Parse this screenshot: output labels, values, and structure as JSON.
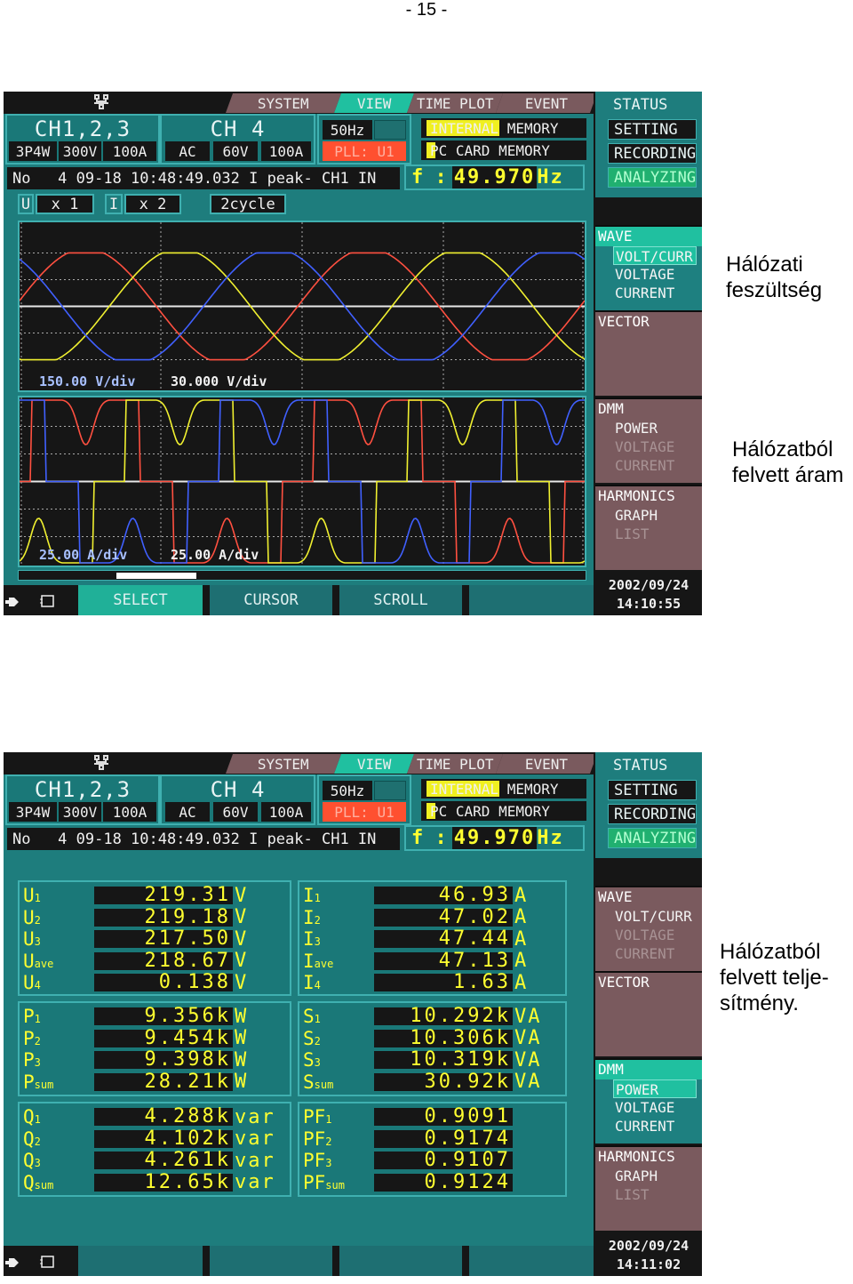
{
  "page_number": "- 15 -",
  "captions": [
    "Hálózati\nfeszültség",
    "Hálózatból\nfelvett áram",
    "Hálózatból\nfelvett telje-\nsítmény."
  ],
  "colors": {
    "screen_bg": "#1e7d7d",
    "active": "#20c0a0",
    "inactive": "#7a5a5e",
    "lcd_black": "#161616",
    "value_yellow": "#ffff30",
    "phase1": "#ff5040",
    "phase2": "#f0f030",
    "phase3": "#4060ff",
    "pll": "#ff5030"
  },
  "screens": [
    {
      "tabs": [
        "SYSTEM",
        "VIEW",
        "TIME PLOT",
        "EVENT"
      ],
      "active_tab": "VIEW",
      "network_icon": "network-icon",
      "ch123": {
        "title": "CH1,2,3",
        "settings": [
          "3P4W",
          "300V",
          "100A"
        ]
      },
      "ch4": {
        "title": "CH 4",
        "settings": [
          "AC",
          "60V",
          "100A"
        ]
      },
      "freq": "50Hz",
      "pll": "PLL: U1",
      "memory": [
        "INTERNAL MEMORY",
        "PC CARD MEMORY"
      ],
      "event": "No   4 09-18 10:48:49.032 I peak- CH1 IN",
      "f_label": "f :",
      "f_value": "49.970",
      "f_unit": "Hz",
      "zoom": {
        "u_label": "U",
        "u_value": "x 1",
        "i_label": "I",
        "i_value": "x 2",
        "cycles": "2cycle"
      },
      "voltage_scales": [
        "150.00 V/div",
        "30.000 V/div"
      ],
      "current_scales": [
        "25.00 A/div",
        "25.00 A/div"
      ],
      "scroll_position": 0.2,
      "status": [
        "STATUS",
        "SETTING",
        "RECORDING",
        "ANALYZING"
      ],
      "nav": [
        {
          "head": "WAVE",
          "active": true,
          "items": [
            {
              "label": "VOLT/CURR",
              "state": "selected"
            },
            {
              "label": "VOLTAGE",
              "state": "enabled"
            },
            {
              "label": "CURRENT",
              "state": "enabled"
            }
          ]
        },
        {
          "head": "VECTOR",
          "active": false,
          "items": []
        },
        {
          "head": "DMM",
          "active": false,
          "items": [
            {
              "label": "POWER",
              "state": "enabled"
            },
            {
              "label": "VOLTAGE",
              "state": "disabled"
            },
            {
              "label": "CURRENT",
              "state": "disabled"
            }
          ]
        },
        {
          "head": "HARMONICS",
          "active": false,
          "items": [
            {
              "label": "GRAPH",
              "state": "enabled"
            },
            {
              "label": "LIST",
              "state": "disabled"
            }
          ]
        }
      ],
      "date": "2002/09/24",
      "time": "14:10:55",
      "buttons": [
        "SELECT",
        "CURSOR",
        "SCROLL",
        ""
      ]
    },
    {
      "tabs": [
        "SYSTEM",
        "VIEW",
        "TIME PLOT",
        "EVENT"
      ],
      "active_tab": "VIEW",
      "network_icon": "network-icon",
      "ch123": {
        "title": "CH1,2,3",
        "settings": [
          "3P4W",
          "300V",
          "100A"
        ]
      },
      "ch4": {
        "title": "CH 4",
        "settings": [
          "AC",
          "60V",
          "100A"
        ]
      },
      "freq": "50Hz",
      "pll": "PLL: U1",
      "memory": [
        "INTERNAL MEMORY",
        "PC CARD MEMORY"
      ],
      "event": "No   4 09-18 10:48:49.032 I peak- CH1 IN",
      "f_label": "f :",
      "f_value": "49.970",
      "f_unit": "Hz",
      "dmm": [
        [
          [
            {
              "l": "U",
              "s": "1",
              "v": "219.31",
              "u": "V"
            },
            {
              "l": "U",
              "s": "2",
              "v": "219.18",
              "u": "V"
            },
            {
              "l": "U",
              "s": "3",
              "v": "217.50",
              "u": "V"
            },
            {
              "l": "U",
              "s": "ave",
              "v": "218.67",
              "u": "V"
            },
            {
              "l": "U",
              "s": "4",
              "v": "0.138",
              "u": "V"
            }
          ],
          [
            {
              "l": "I",
              "s": "1",
              "v": "46.93",
              "u": "A"
            },
            {
              "l": "I",
              "s": "2",
              "v": "47.02",
              "u": "A"
            },
            {
              "l": "I",
              "s": "3",
              "v": "47.44",
              "u": "A"
            },
            {
              "l": "I",
              "s": "ave",
              "v": "47.13",
              "u": "A"
            },
            {
              "l": "I",
              "s": "4",
              "v": "1.63",
              "u": "A"
            }
          ]
        ],
        [
          [
            {
              "l": "P",
              "s": "1",
              "v": "9.356k",
              "u": "W"
            },
            {
              "l": "P",
              "s": "2",
              "v": "9.454k",
              "u": "W"
            },
            {
              "l": "P",
              "s": "3",
              "v": "9.398k",
              "u": "W"
            },
            {
              "l": "P",
              "s": "sum",
              "v": "28.21k",
              "u": "W"
            }
          ],
          [
            {
              "l": "S",
              "s": "1",
              "v": "10.292k",
              "u": "VA"
            },
            {
              "l": "S",
              "s": "2",
              "v": "10.306k",
              "u": "VA"
            },
            {
              "l": "S",
              "s": "3",
              "v": "10.319k",
              "u": "VA"
            },
            {
              "l": "S",
              "s": "sum",
              "v": "30.92k",
              "u": "VA"
            }
          ]
        ],
        [
          [
            {
              "l": "Q",
              "s": "1",
              "v": "4.288k",
              "u": "var"
            },
            {
              "l": "Q",
              "s": "2",
              "v": "4.102k",
              "u": "var"
            },
            {
              "l": "Q",
              "s": "3",
              "v": "4.261k",
              "u": "var"
            },
            {
              "l": "Q",
              "s": "sum",
              "v": "12.65k",
              "u": "var"
            }
          ],
          [
            {
              "l": "PF",
              "s": "1",
              "v": "0.9091",
              "u": ""
            },
            {
              "l": "PF",
              "s": "2",
              "v": "0.9174",
              "u": ""
            },
            {
              "l": "PF",
              "s": "3",
              "v": "0.9107",
              "u": ""
            },
            {
              "l": "PF",
              "s": "sum",
              "v": "0.9124",
              "u": ""
            }
          ]
        ]
      ],
      "status": [
        "STATUS",
        "SETTING",
        "RECORDING",
        "ANALYZING"
      ],
      "nav": [
        {
          "head": "WAVE",
          "active": false,
          "items": [
            {
              "label": "VOLT/CURR",
              "state": "enabled"
            },
            {
              "label": "VOLTAGE",
              "state": "disabled"
            },
            {
              "label": "CURRENT",
              "state": "disabled"
            }
          ]
        },
        {
          "head": "VECTOR",
          "active": false,
          "items": []
        },
        {
          "head": "DMM",
          "active": true,
          "items": [
            {
              "label": "POWER",
              "state": "selected"
            },
            {
              "label": "VOLTAGE",
              "state": "enabled"
            },
            {
              "label": "CURRENT",
              "state": "enabled"
            }
          ]
        },
        {
          "head": "HARMONICS",
          "active": false,
          "items": [
            {
              "label": "GRAPH",
              "state": "enabled"
            },
            {
              "label": "LIST",
              "state": "disabled"
            }
          ]
        }
      ],
      "date": "2002/09/24",
      "time": "14:11:02",
      "buttons": [
        "",
        "",
        "",
        ""
      ]
    }
  ]
}
